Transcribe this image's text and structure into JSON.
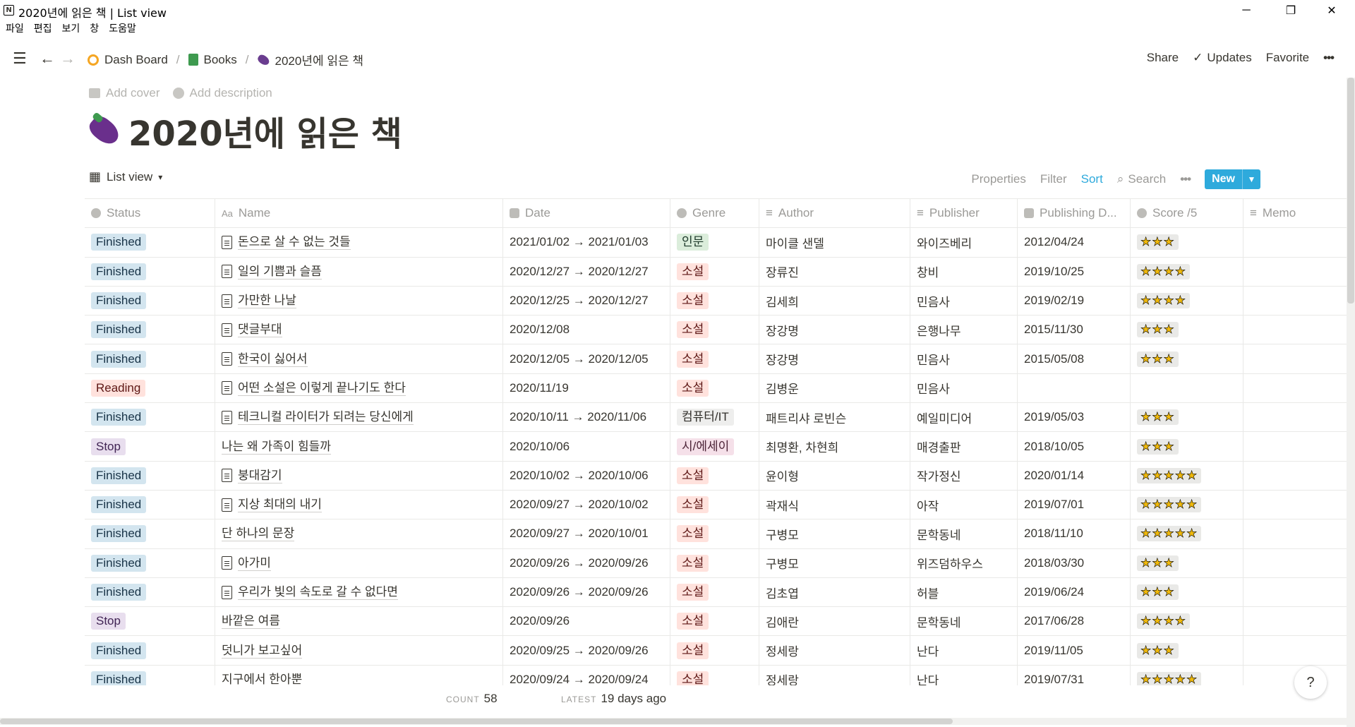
{
  "window": {
    "title": "2020년에 읽은 책 | List view",
    "minimize": "─",
    "maximize": "❐",
    "close": "✕"
  },
  "menu": [
    "파일",
    "편집",
    "보기",
    "창",
    "도움말"
  ],
  "nav": {
    "breadcrumb": [
      {
        "label": "Dash Board",
        "icon": "dashboard-icon"
      },
      {
        "label": "Books",
        "icon": "green-book-icon"
      },
      {
        "label": "2020년에 읽은 책",
        "icon": "eggplant-icon"
      }
    ],
    "separator": "/",
    "share": "Share",
    "updates": "Updates",
    "favorite": "Favorite",
    "more": "•••"
  },
  "page": {
    "add_cover": "Add cover",
    "add_description": "Add description",
    "title": "2020년에 읽은 책"
  },
  "view": {
    "name": "List view",
    "properties": "Properties",
    "filter": "Filter",
    "sort": "Sort",
    "search": "Search",
    "more": "•••",
    "new": "New"
  },
  "columns": [
    "Status",
    "Name",
    "Date",
    "Genre",
    "Author",
    "Publisher",
    "Publishing D...",
    "Score /5",
    "Memo"
  ],
  "rows": [
    {
      "status": "Finished",
      "name": "돈으로 살 수 없는 것들",
      "doc": true,
      "date": "2021/01/02 → 2021/01/03",
      "genre": "인문",
      "author": "마이클 샌델",
      "publisher": "와이즈베리",
      "pubdate": "2012/04/24",
      "score": 3
    },
    {
      "status": "Finished",
      "name": "일의 기쁨과 슬픔",
      "doc": true,
      "date": "2020/12/27 → 2020/12/27",
      "genre": "소설",
      "author": "장류진",
      "publisher": "창비",
      "pubdate": "2019/10/25",
      "score": 4
    },
    {
      "status": "Finished",
      "name": "가만한 나날",
      "doc": true,
      "date": "2020/12/25 → 2020/12/27",
      "genre": "소설",
      "author": "김세희",
      "publisher": "민음사",
      "pubdate": "2019/02/19",
      "score": 4
    },
    {
      "status": "Finished",
      "name": "댓글부대",
      "doc": true,
      "date": "2020/12/08",
      "genre": "소설",
      "author": "장강명",
      "publisher": "은행나무",
      "pubdate": "2015/11/30",
      "score": 3
    },
    {
      "status": "Finished",
      "name": "한국이 싫어서",
      "doc": true,
      "date": "2020/12/05 → 2020/12/05",
      "genre": "소설",
      "author": "장강명",
      "publisher": "민음사",
      "pubdate": "2015/05/08",
      "score": 3
    },
    {
      "status": "Reading",
      "name": "어떤 소설은 이렇게 끝나기도 한다",
      "doc": true,
      "date": "2020/11/19",
      "genre": "소설",
      "author": "김병운",
      "publisher": "민음사",
      "pubdate": "",
      "score": 0
    },
    {
      "status": "Finished",
      "name": "테크니컬 라이터가 되려는 당신에게",
      "doc": true,
      "date": "2020/10/11 → 2020/11/06",
      "genre": "컴퓨터/IT",
      "author": "패트리샤 로빈슨",
      "publisher": "예일미디어",
      "pubdate": "2019/05/03",
      "score": 3
    },
    {
      "status": "Stop",
      "name": "나는 왜 가족이 힘들까",
      "doc": false,
      "date": "2020/10/06",
      "genre": "시/에세이",
      "author": "최명환, 차현희",
      "publisher": "매경출판",
      "pubdate": "2018/10/05",
      "score": 3
    },
    {
      "status": "Finished",
      "name": "붕대감기",
      "doc": true,
      "date": "2020/10/02 → 2020/10/06",
      "genre": "소설",
      "author": "윤이형",
      "publisher": "작가정신",
      "pubdate": "2020/01/14",
      "score": 5
    },
    {
      "status": "Finished",
      "name": "지상 최대의 내기",
      "doc": true,
      "date": "2020/09/27 → 2020/10/02",
      "genre": "소설",
      "author": "곽재식",
      "publisher": "아작",
      "pubdate": "2019/07/01",
      "score": 5
    },
    {
      "status": "Finished",
      "name": "단 하나의 문장",
      "doc": false,
      "date": "2020/09/27 → 2020/10/01",
      "genre": "소설",
      "author": "구병모",
      "publisher": "문학동네",
      "pubdate": "2018/11/10",
      "score": 5
    },
    {
      "status": "Finished",
      "name": "아가미",
      "doc": true,
      "date": "2020/09/26 → 2020/09/26",
      "genre": "소설",
      "author": "구병모",
      "publisher": "위즈덤하우스",
      "pubdate": "2018/03/30",
      "score": 3
    },
    {
      "status": "Finished",
      "name": "우리가 빛의 속도로 갈 수 없다면",
      "doc": true,
      "date": "2020/09/26 → 2020/09/26",
      "genre": "소설",
      "author": "김초엽",
      "publisher": "허블",
      "pubdate": "2019/06/24",
      "score": 3
    },
    {
      "status": "Stop",
      "name": "바깥은 여름",
      "doc": false,
      "date": "2020/09/26",
      "genre": "소설",
      "author": "김애란",
      "publisher": "문학동네",
      "pubdate": "2017/06/28",
      "score": 4
    },
    {
      "status": "Finished",
      "name": "덧니가 보고싶어",
      "doc": false,
      "date": "2020/09/25 → 2020/09/26",
      "genre": "소설",
      "author": "정세랑",
      "publisher": "난다",
      "pubdate": "2019/11/05",
      "score": 3
    },
    {
      "status": "Finished",
      "name": "지구에서 한아뿐",
      "doc": false,
      "date": "2020/09/24 → 2020/09/24",
      "genre": "소설",
      "author": "정세랑",
      "publisher": "난다",
      "pubdate": "2019/07/31",
      "score": 5
    }
  ],
  "footer": {
    "count_label": "COUNT",
    "count_value": "58",
    "latest_label": "LATEST",
    "latest_value": "19 days ago"
  },
  "help": "?",
  "colors": {
    "accent": "#2eaadc",
    "status_finished": "#d3e5ef",
    "status_reading": "#ffe2dd",
    "status_stop": "#e8deee"
  }
}
